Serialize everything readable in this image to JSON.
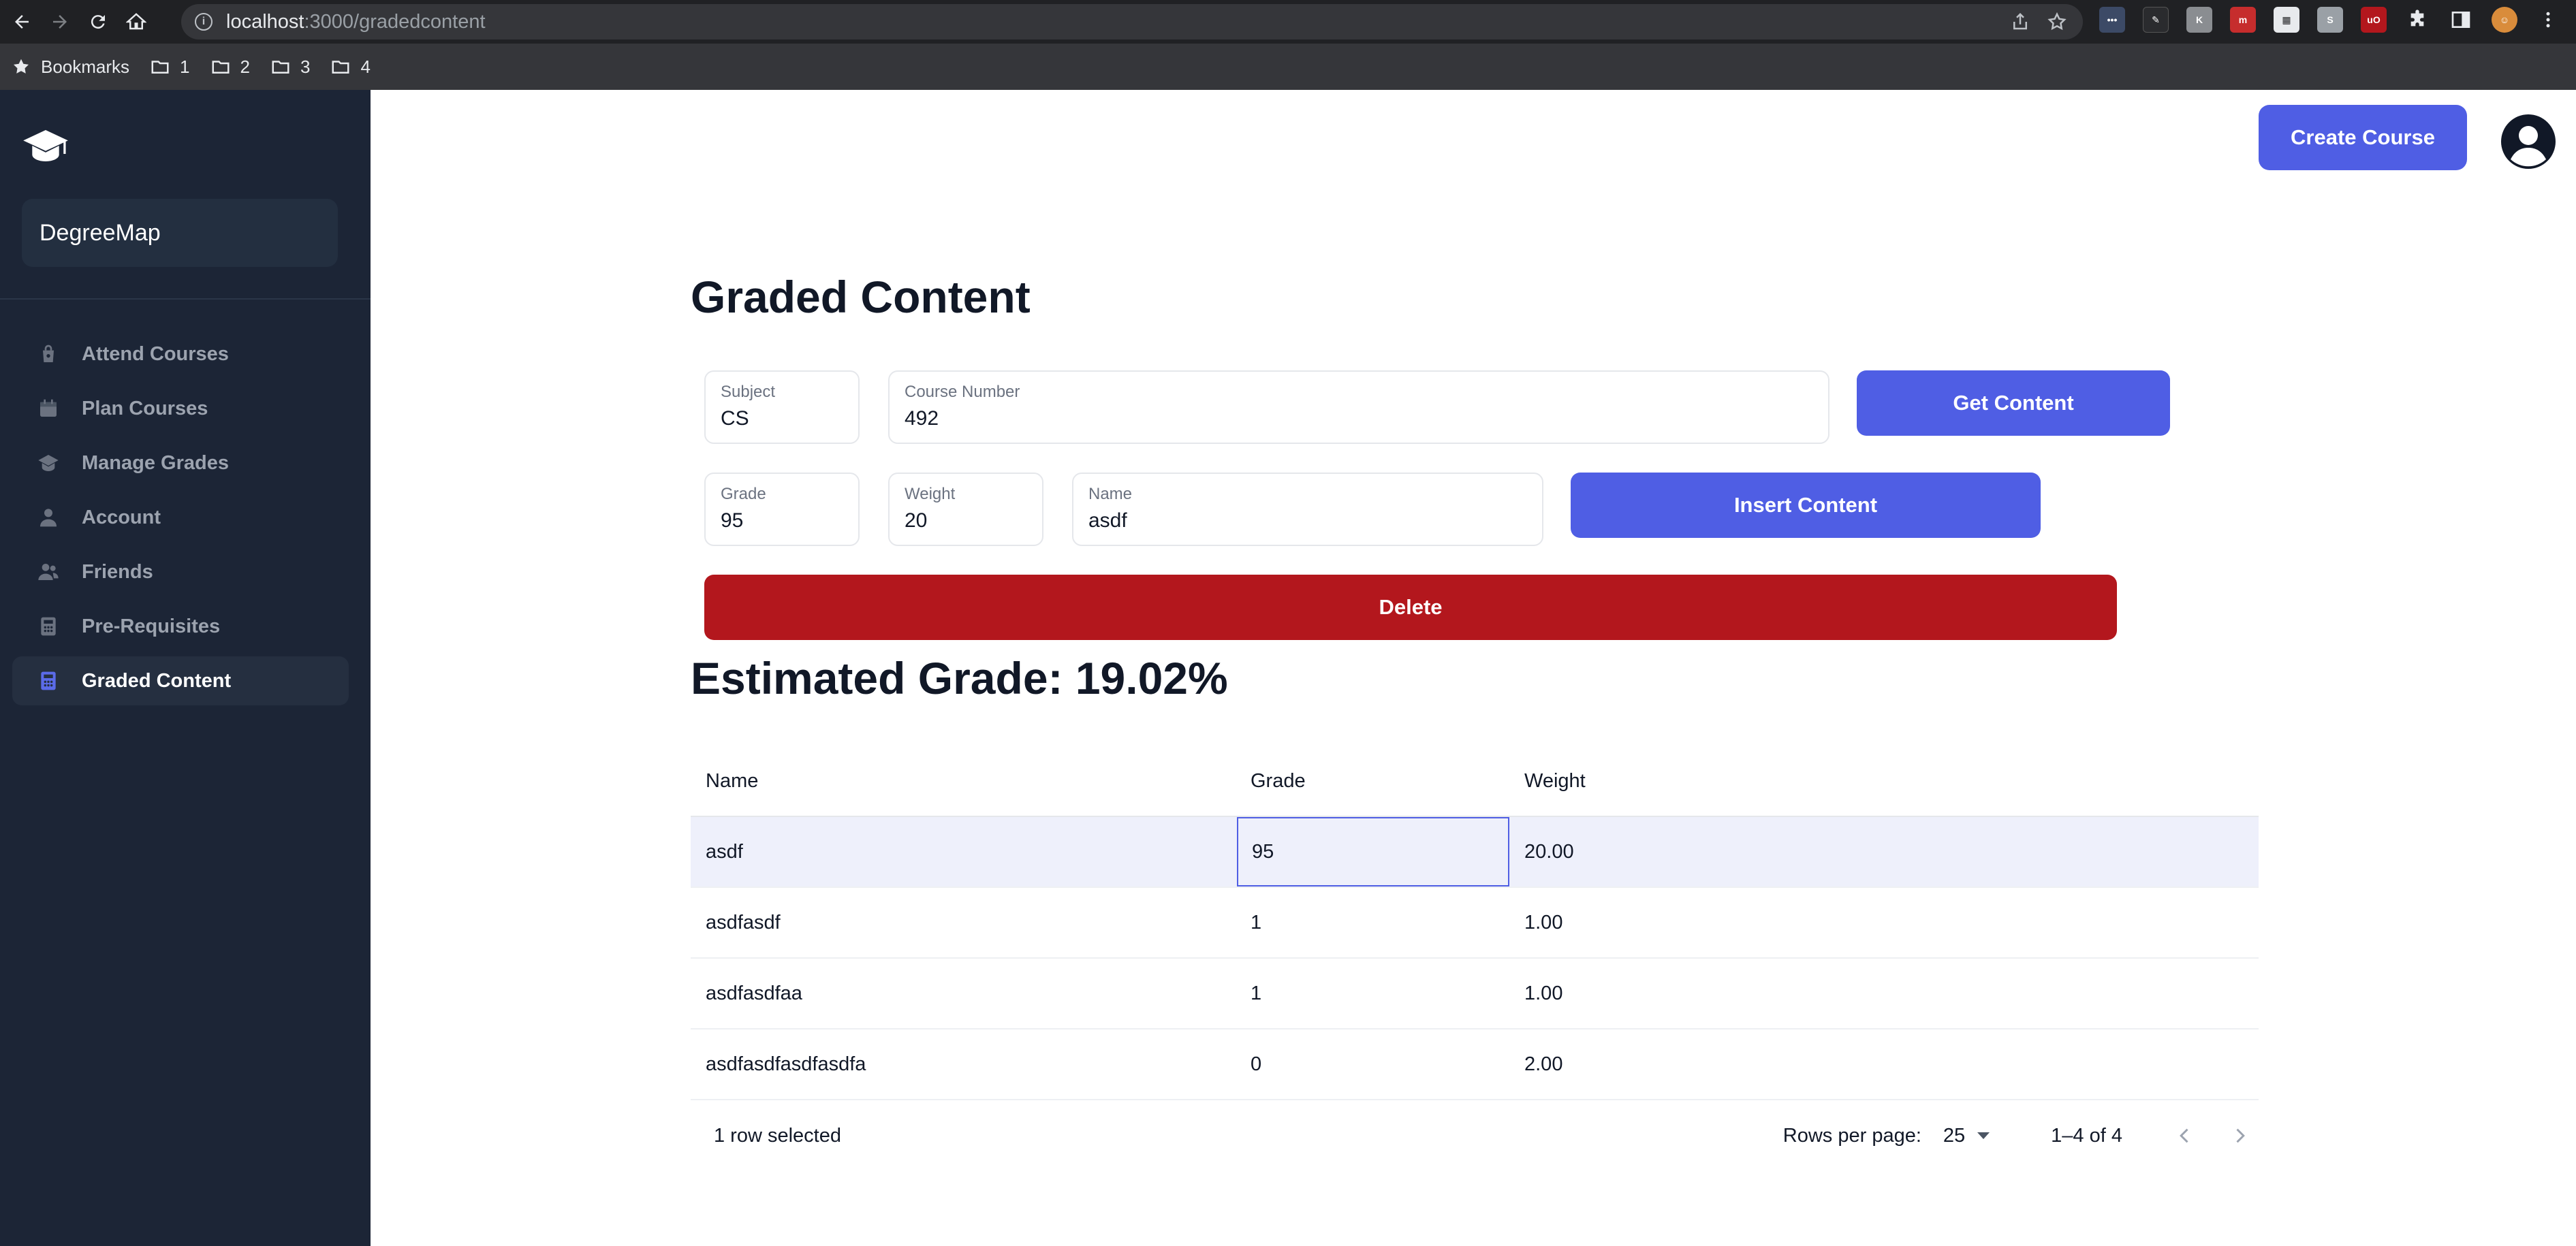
{
  "browser": {
    "url_host": "localhost",
    "url_path": ":3000/gradedcontent",
    "bookmarks_label": "Bookmarks",
    "folders": [
      "1",
      "2",
      "3",
      "4"
    ]
  },
  "sidebar": {
    "brand": "DegreeMap",
    "items": [
      {
        "label": "Attend Courses",
        "icon": "bag-icon"
      },
      {
        "label": "Plan Courses",
        "icon": "calendar-icon"
      },
      {
        "label": "Manage Grades",
        "icon": "graduation-icon"
      },
      {
        "label": "Account",
        "icon": "user-icon"
      },
      {
        "label": "Friends",
        "icon": "users-icon"
      },
      {
        "label": "Pre-Requisites",
        "icon": "calculator-icon"
      },
      {
        "label": "Graded Content",
        "icon": "calculator-icon",
        "active": true
      }
    ]
  },
  "header": {
    "create_label": "Create Course"
  },
  "main": {
    "title": "Graded Content",
    "subject": {
      "label": "Subject",
      "value": "CS"
    },
    "course_number": {
      "label": "Course Number",
      "value": "492"
    },
    "get_label": "Get Content",
    "grade": {
      "label": "Grade",
      "value": "95"
    },
    "weight": {
      "label": "Weight",
      "value": "20"
    },
    "name": {
      "label": "Name",
      "value": "asdf"
    },
    "insert_label": "Insert Content",
    "delete_label": "Delete",
    "estimated": "Estimated Grade: 19.02%"
  },
  "table": {
    "columns": [
      "Name",
      "Grade",
      "Weight"
    ],
    "rows": [
      {
        "name": "asdf",
        "grade": "95",
        "weight": "20.00"
      },
      {
        "name": "asdfasdf",
        "grade": "1",
        "weight": "1.00"
      },
      {
        "name": "asdfasdfaa",
        "grade": "1",
        "weight": "1.00"
      },
      {
        "name": "asdfasdfasdfasdfa",
        "grade": "0",
        "weight": "2.00"
      }
    ],
    "selected_text": "1 row selected",
    "rows_per_page_label": "Rows per page:",
    "rows_per_page": "25",
    "range": "1–4 of 4"
  },
  "colors": {
    "accent": "#4f5ee4",
    "danger": "#b3171d",
    "sidebar_bg": "#1c2536"
  }
}
